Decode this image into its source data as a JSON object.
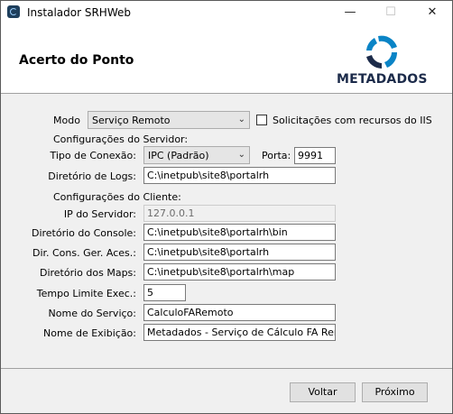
{
  "window": {
    "title": "Instalador SRHWeb",
    "minimize": "—",
    "maximize": "☐",
    "close": "✕"
  },
  "header": {
    "title": "Acerto do Ponto",
    "logo_text": "METADADOS"
  },
  "form": {
    "modo_label": "Modo",
    "modo_value": "Serviço Remoto",
    "iis_checkbox_label": "Solicitações com recursos do IIS",
    "iis_checked": false,
    "server_section": "Configurações do Servidor:",
    "tipo_conexao_label": "Tipo de Conexão:",
    "tipo_conexao_value": "IPC (Padrão)",
    "porta_label": "Porta:",
    "porta_value": "9991",
    "dir_logs_label": "Diretório de Logs:",
    "dir_logs_value": "C:\\inetpub\\site8\\portalrh",
    "client_section": "Configurações do Cliente:",
    "ip_label": "IP do Servidor:",
    "ip_value": "127.0.0.1",
    "dir_console_label": "Diretório do Console:",
    "dir_console_value": "C:\\inetpub\\site8\\portalrh\\bin",
    "dir_cons_label": "Dir. Cons. Ger. Aces.:",
    "dir_cons_value": "C:\\inetpub\\site8\\portalrh",
    "dir_maps_label": "Diretório dos Maps:",
    "dir_maps_value": "C:\\inetpub\\site8\\portalrh\\map",
    "tempo_label": "Tempo Limite Exec.:",
    "tempo_value": "5",
    "nome_servico_label": "Nome do Serviço:",
    "nome_servico_value": "CalculoFARemoto",
    "nome_exibicao_label": "Nome de Exibição:",
    "nome_exibicao_value": "Metadados - Serviço de Cálculo FA Remoto"
  },
  "footer": {
    "back_label": "Voltar",
    "next_label": "Próximo"
  },
  "colors": {
    "logo_blue": "#0a84c6",
    "logo_dark": "#1c2b4a"
  }
}
